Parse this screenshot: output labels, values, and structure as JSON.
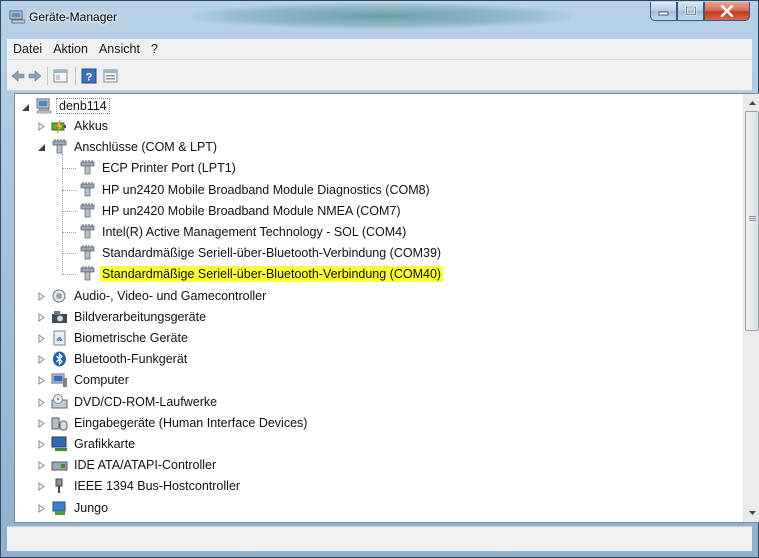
{
  "window": {
    "title": "Geräte-Manager"
  },
  "menu": [
    "Datei",
    "Aktion",
    "Ansicht",
    "?"
  ],
  "toolbar": {
    "back": "back-arrow-icon",
    "forward": "forward-arrow-icon",
    "properties": "properties-icon",
    "help": "help-icon",
    "view": "view-icon"
  },
  "tree": {
    "root": "denb114",
    "items": [
      {
        "label": "Akkus",
        "icon": "battery-icon",
        "state": "collapsed"
      },
      {
        "label": "Anschlüsse (COM & LPT)",
        "icon": "port-icon",
        "state": "expanded",
        "children": [
          "ECP Printer Port (LPT1)",
          "HP un2420 Mobile Broadband Module Diagnostics (COM8)",
          "HP un2420 Mobile Broadband Module NMEA (COM7)",
          "Intel(R) Active Management Technology - SOL (COM4)",
          "Standardmäßige Seriell-über-Bluetooth-Verbindung (COM39)",
          "Standardmäßige Seriell-über-Bluetooth-Verbindung (COM40)"
        ],
        "highlighted_child": 5
      },
      {
        "label": "Audio-, Video- und Gamecontroller",
        "icon": "speaker-icon",
        "state": "collapsed"
      },
      {
        "label": "Bildverarbeitungsgeräte",
        "icon": "camera-icon",
        "state": "collapsed"
      },
      {
        "label": "Biometrische Geräte",
        "icon": "fingerprint-icon",
        "state": "collapsed"
      },
      {
        "label": "Bluetooth-Funkgerät",
        "icon": "bluetooth-icon",
        "state": "collapsed"
      },
      {
        "label": "Computer",
        "icon": "computer-icon",
        "state": "collapsed"
      },
      {
        "label": "DVD/CD-ROM-Laufwerke",
        "icon": "dvd-drive-icon",
        "state": "collapsed"
      },
      {
        "label": "Eingabegeräte (Human Interface Devices)",
        "icon": "hid-icon",
        "state": "collapsed"
      },
      {
        "label": "Grafikkarte",
        "icon": "display-adapter-icon",
        "state": "collapsed"
      },
      {
        "label": "IDE ATA/ATAPI-Controller",
        "icon": "ide-controller-icon",
        "state": "collapsed"
      },
      {
        "label": "IEEE 1394 Bus-Hostcontroller",
        "icon": "firewire-icon",
        "state": "collapsed"
      },
      {
        "label": "Jungo",
        "icon": "jungo-icon",
        "state": "collapsed"
      }
    ]
  },
  "colors": {
    "highlight": "#fbff35",
    "bluetooth": "#1f5fb0"
  }
}
